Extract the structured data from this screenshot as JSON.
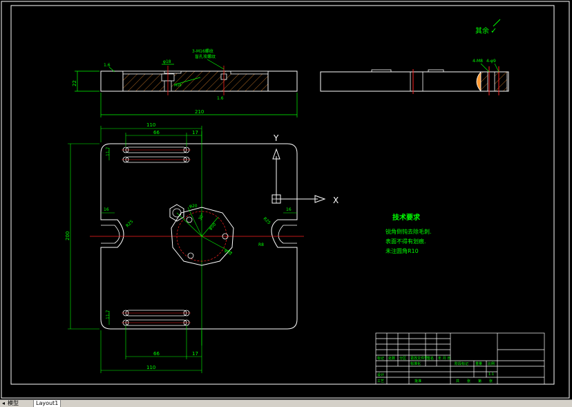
{
  "colors": {
    "background": "#000000",
    "outline": "#ffffff",
    "dimension": "#00ff00",
    "centerline": "#ff2020",
    "hatch": "#ff9933",
    "hole": "#33bbff",
    "axis": "#ffffff"
  },
  "roughness": {
    "note": "其余",
    "symbol": "✓"
  },
  "top_view": {
    "dim_length": "210",
    "dim_height": "22",
    "dim_slot": "φ18",
    "roughness_a": "1.6",
    "roughness_b": "1.6",
    "note_holes_line1": "3-M16螺纹",
    "note_holes_line2": "盲孔攻螺纹"
  },
  "side_view": {
    "note_a": "4-M8",
    "note_b": "4-φ9"
  },
  "plan_view": {
    "dim_width_top": "110",
    "dim_spacing_top": "66",
    "dim_offset_top": "17",
    "dim_width_bottom": "110",
    "dim_spacing_bottom": "66",
    "dim_offset_bottom": "17",
    "dim_height": "200",
    "dim_left_slot": "16",
    "dim_right_slot": "16",
    "dim_row_top": "11.7",
    "dim_row_bottom": "11.7",
    "dim_r_left": "R25",
    "dim_r_right": "R25",
    "dim_bolt_circle": "φ52",
    "dim_polygon": "φ50",
    "dim_angle": "30°",
    "dim_hex": "φ20",
    "dim_r_small": "R8"
  },
  "axes": {
    "y": "Y",
    "x": "X"
  },
  "tech": {
    "title": "技术要求",
    "lines": [
      "锐角倒钝去除毛刺.",
      "表面不得有划痕.",
      "未注圆角R10"
    ]
  },
  "title_block": {
    "row_labels": [
      "标记",
      "处数",
      "分区",
      "更改文件号",
      "签名",
      "年 月 日"
    ],
    "design": "设计",
    "process": "工艺",
    "standard": "标准化",
    "approve": "批准",
    "stage": "阶段标记",
    "weight": "重量",
    "scale": "比例",
    "scale_value": "1:1",
    "sheet_total": "共",
    "sheet": "张",
    "sheet_num": "第",
    "sheet_unit": "张"
  },
  "tabs": {
    "model": "模型",
    "layout": "Layout1"
  }
}
